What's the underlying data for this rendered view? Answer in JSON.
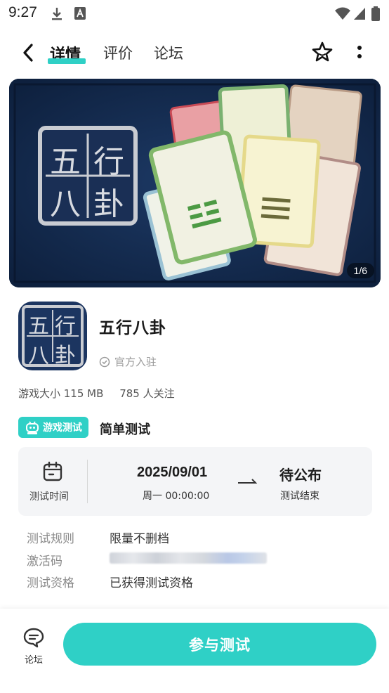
{
  "status_bar": {
    "time": "9:27"
  },
  "nav": {
    "tabs": [
      {
        "label": "详情",
        "active": true
      },
      {
        "label": "评价",
        "active": false
      },
      {
        "label": "论坛",
        "active": false
      }
    ]
  },
  "banner": {
    "logo_text": [
      "五",
      "行",
      "八",
      "卦"
    ],
    "counter": "1/6"
  },
  "app": {
    "name": "五行八卦",
    "official_label": "官方入驻",
    "size_label": "游戏大小 115 MB",
    "followers_label": "785 人关注"
  },
  "test": {
    "badge_label": "游戏测试",
    "type": "简单测试",
    "time_label": "测试时间",
    "start_date": "2025/09/01",
    "start_day": "周一  00:00:00",
    "end_value": "待公布",
    "end_label": "测试结束"
  },
  "info_rows": {
    "rule_key": "测试规则",
    "rule_value": "限量不删档",
    "code_key": "激活码",
    "qual_key": "测试资格",
    "qual_value": "已获得测试资格"
  },
  "bottom": {
    "forum_label": "论坛",
    "join_label": "参与测试"
  },
  "colors": {
    "accent": "#2fd0c6",
    "banner_bg": "#132a4e"
  }
}
